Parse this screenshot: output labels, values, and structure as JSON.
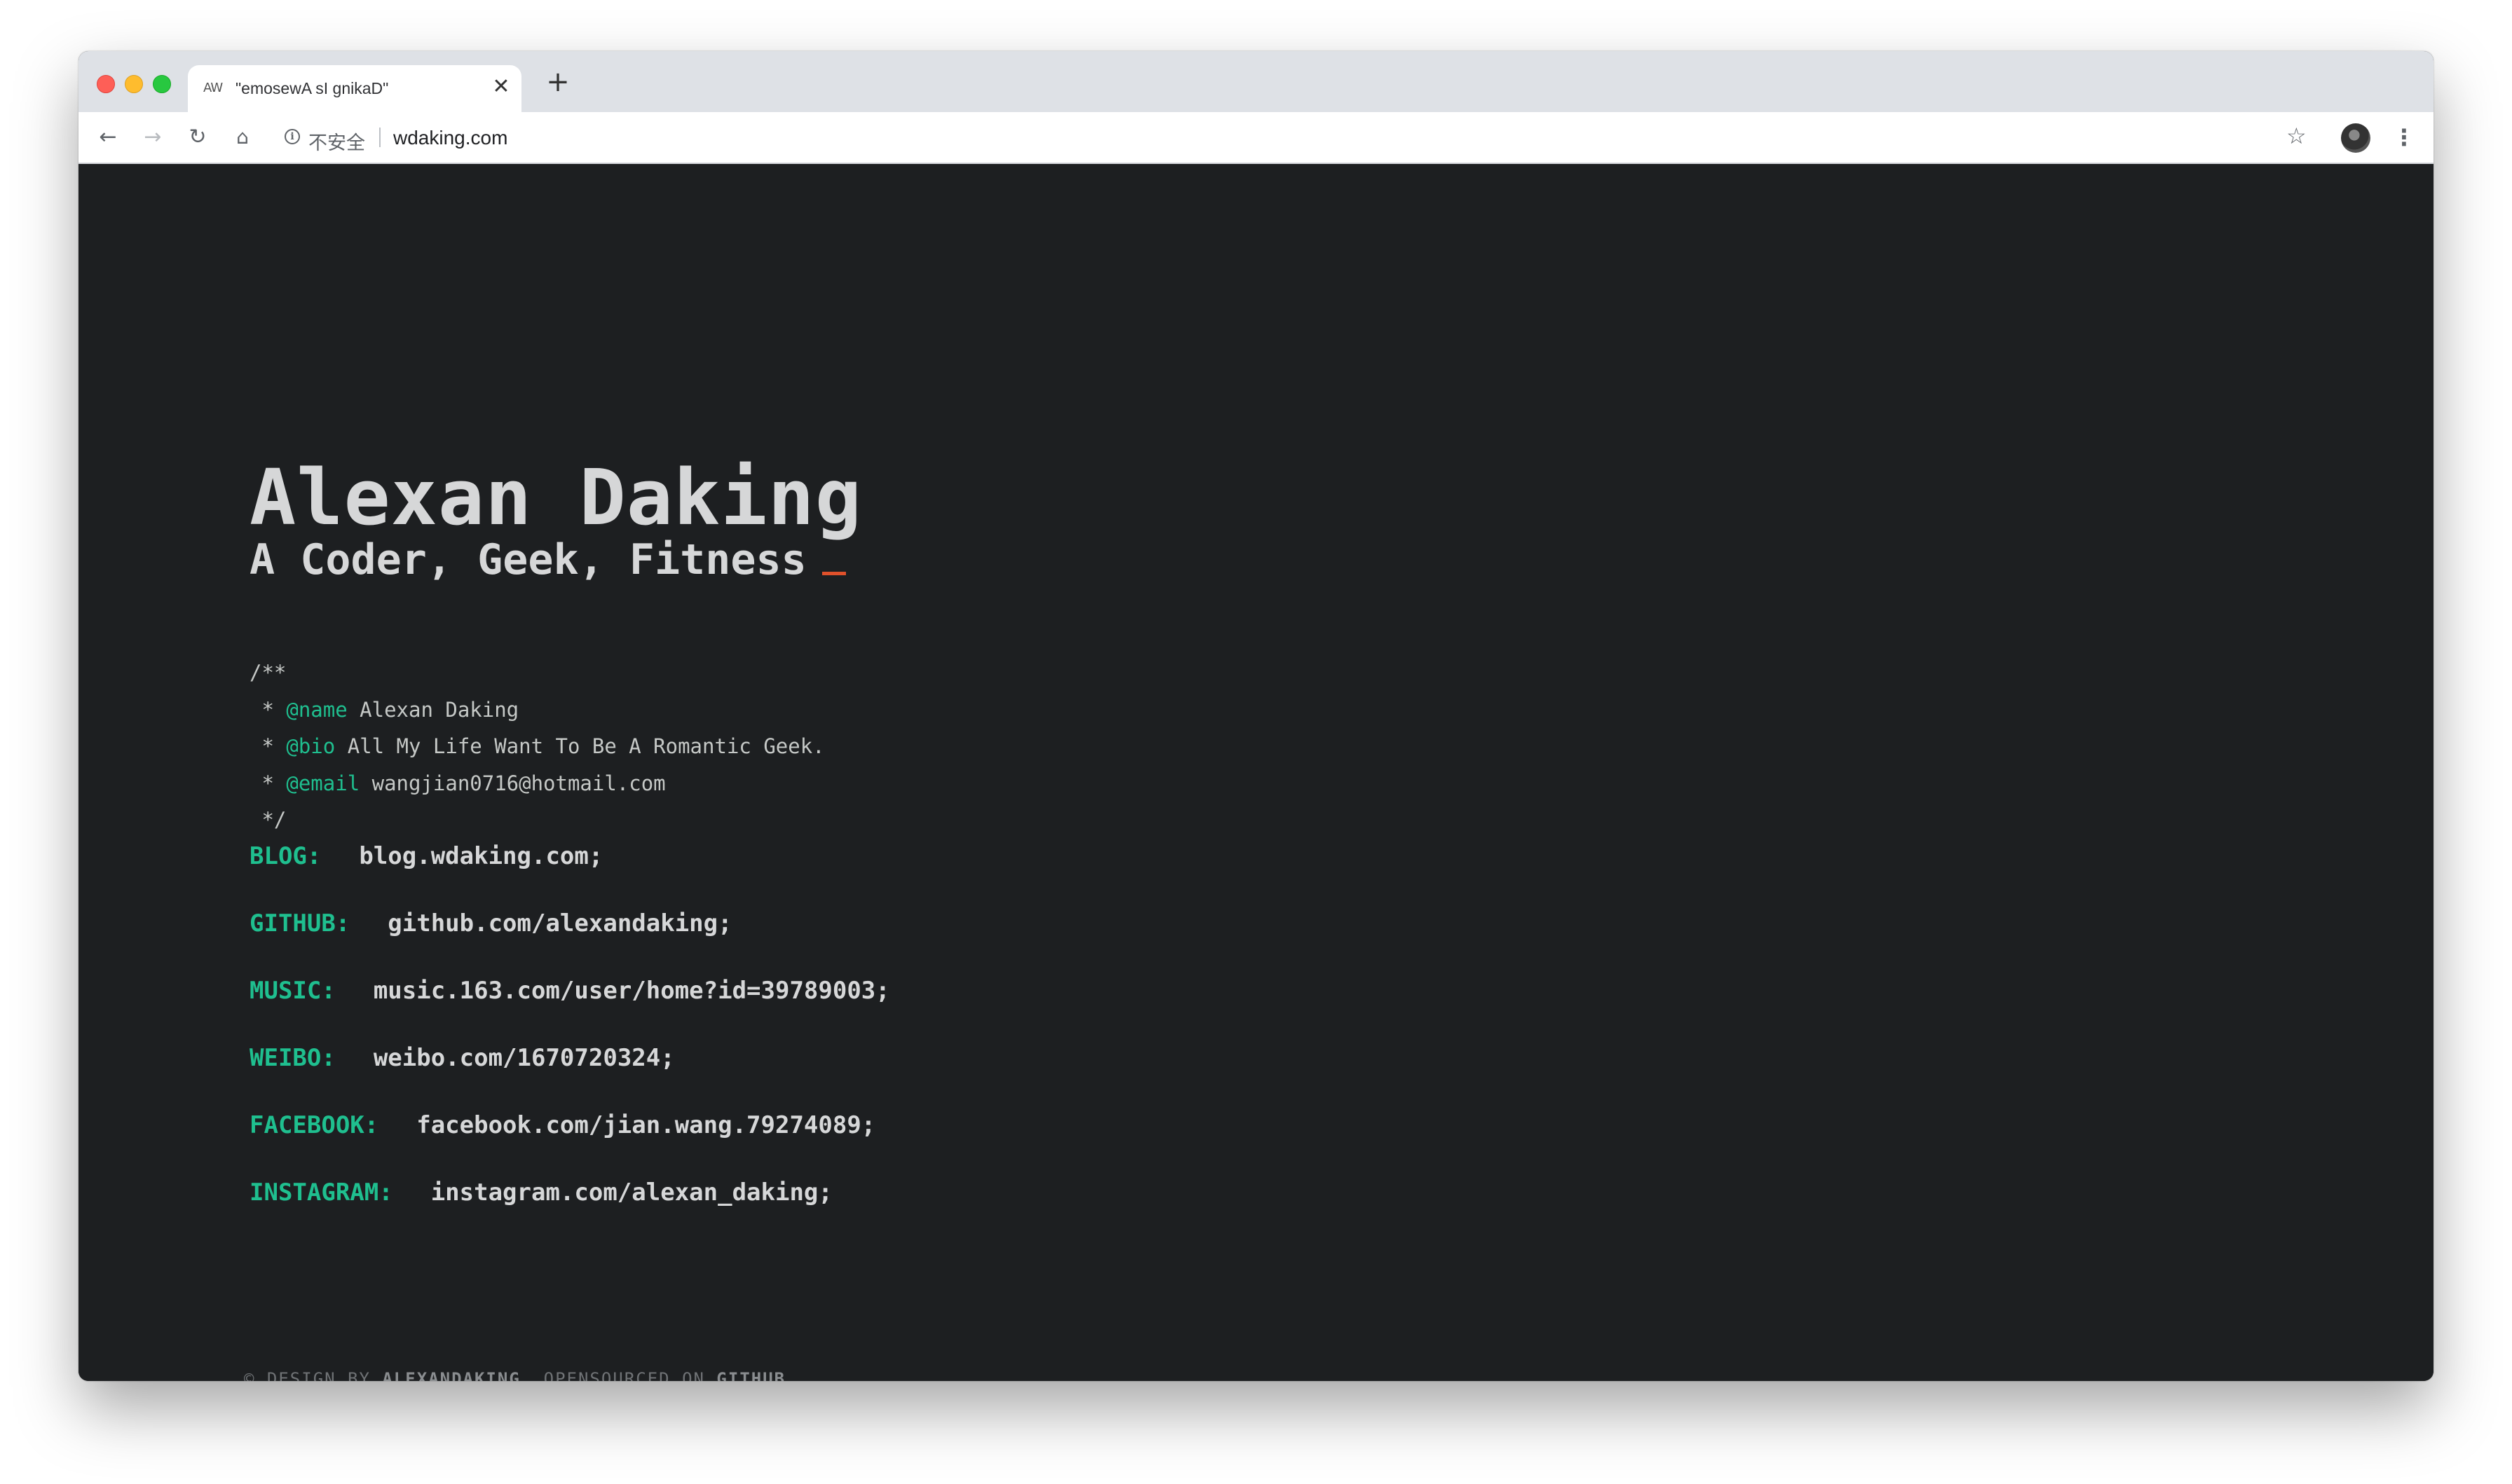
{
  "browser": {
    "tab": {
      "favicon_text": "AW",
      "title": "\"emosewA sI gnikaD\"",
      "close_glyph": "✕"
    },
    "new_tab_glyph": "+",
    "nav": {
      "back_glyph": "←",
      "forward_glyph": "→",
      "reload_glyph": "↻",
      "home_glyph": "⌂"
    },
    "omnibox": {
      "info_glyph": "i",
      "security_label": "不安全",
      "url": "wdaking.com"
    },
    "star_glyph": "☆",
    "menu_glyph": "⋮",
    "icons": [
      "tab-favicon-icon",
      "close-icon",
      "plus-icon",
      "back-arrow-icon",
      "forward-arrow-icon",
      "reload-icon",
      "home-icon",
      "info-icon",
      "star-icon",
      "profile-avatar",
      "more-vertical-icon"
    ]
  },
  "page": {
    "name": "Alexan Daking",
    "tagline": "A Coder, Geek, Fitness",
    "comment": {
      "open": "/**",
      "name_prefix": " * ",
      "name_tag": "@name",
      "name_value": " Alexan Daking",
      "bio_prefix": " * ",
      "bio_tag": "@bio",
      "bio_value": " All My Life Want To Be A Romantic Geek.",
      "email_prefix": " * ",
      "email_tag": "@email",
      "email_value": " wangjian0716@hotmail.com",
      "close": " */"
    },
    "links": [
      {
        "label": "BLOG:",
        "value": "blog.wdaking.com;"
      },
      {
        "label": "GITHUB:",
        "value": "github.com/alexandaking;"
      },
      {
        "label": "MUSIC:",
        "value": "music.163.com/user/home?id=39789003;"
      },
      {
        "label": "WEIBO:",
        "value": "weibo.com/1670720324;"
      },
      {
        "label": "FACEBOOK:",
        "value": "facebook.com/jian.wang.79274089;"
      },
      {
        "label": "INSTAGRAM:",
        "value": "instagram.com/alexan_daking;"
      }
    ],
    "footer": {
      "prefix": "© DESIGN BY ",
      "author_link": "ALEXANDAKING",
      "middle": ", OPENSOURCED ON ",
      "github_link": "GITHUB"
    },
    "colors": {
      "background": "#1d1f21",
      "text": "#d6d7d8",
      "accent": "#1fbf8f",
      "cursor": "#e0512b"
    }
  }
}
